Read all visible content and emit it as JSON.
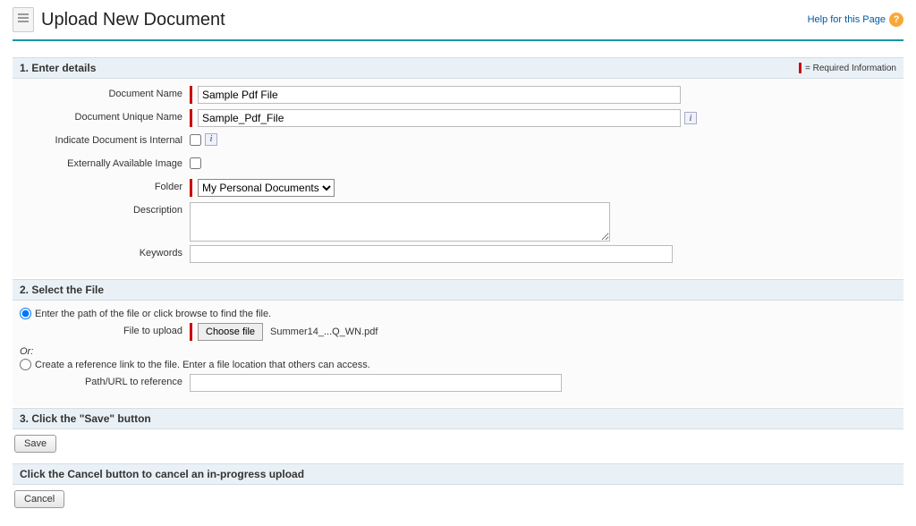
{
  "header": {
    "title": "Upload New Document",
    "help_label": "Help for this Page"
  },
  "sections": {
    "s1": {
      "title": "1. Enter details",
      "req_legend": "= Required Information",
      "labels": {
        "doc_name": "Document Name",
        "unique_name": "Document Unique Name",
        "internal": "Indicate Document is Internal",
        "ext_image": "Externally Available Image",
        "folder": "Folder",
        "description": "Description",
        "keywords": "Keywords"
      },
      "values": {
        "doc_name": "Sample Pdf File",
        "unique_name": "Sample_Pdf_File",
        "folder_selected": "My Personal Documents",
        "description": "",
        "keywords": ""
      }
    },
    "s2": {
      "title": "2. Select the File",
      "opt1": "Enter the path of the file or click browse to find the file.",
      "file_label": "File to upload",
      "choose_btn": "Choose file",
      "chosen_file": "Summer14_...Q_WN.pdf",
      "or": "Or:",
      "opt2": "Create a reference link to the file. Enter a file location that others can access.",
      "path_label": "Path/URL to reference",
      "path_value": ""
    },
    "s3": {
      "title": "3. Click the \"Save\" button",
      "save_btn": "Save"
    },
    "s4": {
      "title": "Click the Cancel button to cancel an in-progress upload",
      "cancel_btn": "Cancel"
    }
  }
}
